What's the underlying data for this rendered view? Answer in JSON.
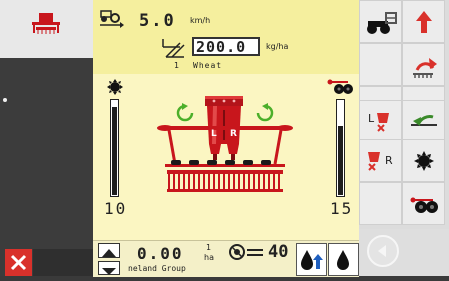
{
  "speed": {
    "value": "5.0",
    "unit": "km/h"
  },
  "rate": {
    "value": "200.0",
    "unit": "kg/ha",
    "product_index": "1",
    "product_name": "Wheat"
  },
  "gauges": {
    "left_value": "10",
    "right_value": "15",
    "left_fill": 0.92,
    "right_fill": 0.72
  },
  "area": {
    "value": "0.00",
    "index": "1",
    "unit": "ha"
  },
  "tramline": {
    "value": "40"
  },
  "company": {
    "label": "neland Group"
  },
  "machine": {
    "lr_left": "L",
    "lr_right": "R"
  },
  "right_panel": {
    "l_label": "L",
    "r_label": "R"
  },
  "colors": {
    "accent_red": "#d9312b",
    "panel_yellow": "#f5ef9e",
    "machine_red": "#c8161c"
  },
  "icons": [
    "machine-icon",
    "tractor-gear-icon",
    "red-up-arrow-icon",
    "seeder-arrow-icon",
    "seed-block-left-icon",
    "seed-arrow-left-icon",
    "seed-block-right-icon",
    "fan-icon",
    "seeder-wheels-icon",
    "close-icon",
    "up-arrow-icon",
    "down-arrow-icon",
    "tramline-icon",
    "fill-icon",
    "back-icon"
  ]
}
